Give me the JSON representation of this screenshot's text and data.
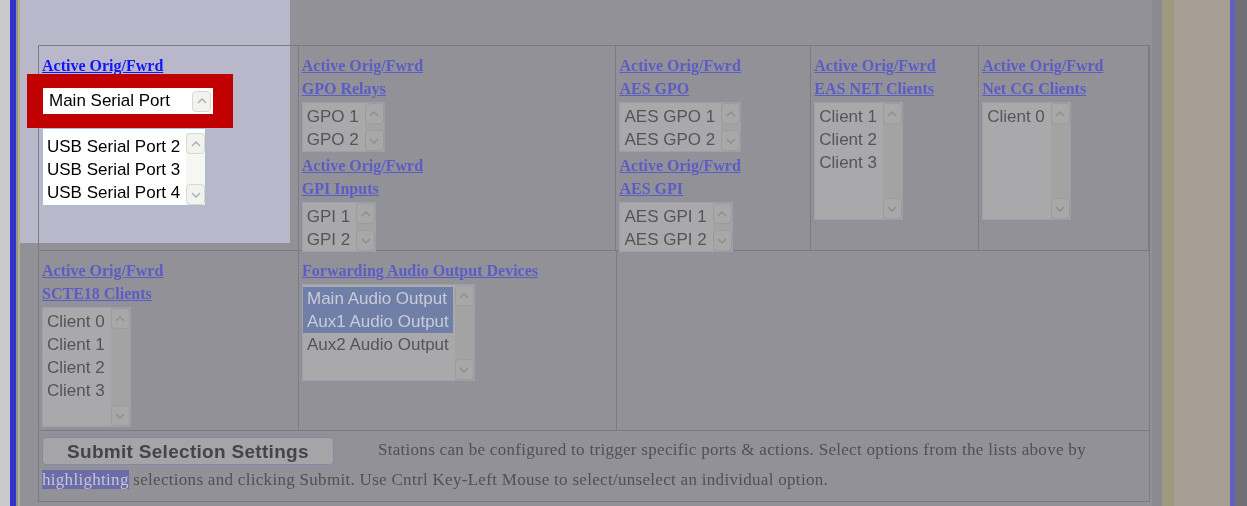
{
  "rows": [
    {
      "cells": [
        {
          "highlighted": true,
          "groups": [
            {
              "heading": [
                "Active Orig/Fwrd"
              ],
              "callout": {
                "value": "Main Serial Port"
              },
              "options": [
                {
                  "label": "USB Serial Port 2",
                  "selected": false
                },
                {
                  "label": "USB Serial Port 3",
                  "selected": false
                },
                {
                  "label": "USB Serial Port 4",
                  "selected": false
                }
              ]
            }
          ]
        },
        {
          "highlighted": false,
          "groups": [
            {
              "heading": [
                "Active Orig/Fwrd",
                "GPO Relays"
              ],
              "options": [
                {
                  "label": "GPO 1",
                  "selected": false
                },
                {
                  "label": "GPO 2",
                  "selected": false
                }
              ]
            },
            {
              "heading": [
                "Active Orig/Fwrd",
                "GPI Inputs"
              ],
              "options": [
                {
                  "label": "GPI 1",
                  "selected": false
                },
                {
                  "label": "GPI 2",
                  "selected": false
                }
              ]
            }
          ]
        },
        {
          "highlighted": false,
          "groups": [
            {
              "heading": [
                "Active Orig/Fwrd",
                "AES GPO"
              ],
              "options": [
                {
                  "label": "AES GPO 1",
                  "selected": false
                },
                {
                  "label": "AES GPO 2",
                  "selected": false
                }
              ]
            },
            {
              "heading": [
                "Active Orig/Fwrd",
                "AES GPI"
              ],
              "options": [
                {
                  "label": "AES GPI 1",
                  "selected": false
                },
                {
                  "label": "AES GPI 2",
                  "selected": false
                }
              ]
            }
          ]
        },
        {
          "highlighted": false,
          "groups": [
            {
              "heading": [
                "Active Orig/Fwrd",
                "EAS NET Clients"
              ],
              "options": [
                {
                  "label": "Client 1",
                  "selected": false
                },
                {
                  "label": "Client 2",
                  "selected": false
                },
                {
                  "label": "Client 3",
                  "selected": false
                }
              ]
            }
          ]
        },
        {
          "highlighted": false,
          "groups": [
            {
              "heading": [
                "Active Orig/Fwrd",
                "Net CG Clients"
              ],
              "options": [
                {
                  "label": "Client 0",
                  "selected": false
                }
              ]
            }
          ]
        }
      ]
    },
    {
      "cells": [
        {
          "highlighted": false,
          "groups": [
            {
              "heading": [
                "Active Orig/Fwrd",
                "SCTE18 Clients"
              ],
              "options": [
                {
                  "label": "Client 0",
                  "selected": false
                },
                {
                  "label": "Client 1",
                  "selected": false
                },
                {
                  "label": "Client 2",
                  "selected": false
                },
                {
                  "label": "Client 3",
                  "selected": false
                }
              ]
            }
          ]
        },
        {
          "highlighted": false,
          "groups": [
            {
              "heading": [
                "Forwarding Audio Output Devices"
              ],
              "options": [
                {
                  "label": "Main Audio Output",
                  "selected": true
                },
                {
                  "label": "Aux1 Audio Output",
                  "selected": true
                },
                {
                  "label": "Aux2 Audio Output",
                  "selected": false
                }
              ]
            }
          ]
        }
      ]
    }
  ],
  "submit_button": "Submit Selection Settings",
  "help": {
    "before": "Stations can be configured to trigger specific ports & actions. Select options from the lists above by ",
    "highlight": "highlighting",
    "after": " selections and clicking Submit. Use Cntrl Key-Left Mouse to select/unselect an individual option."
  }
}
